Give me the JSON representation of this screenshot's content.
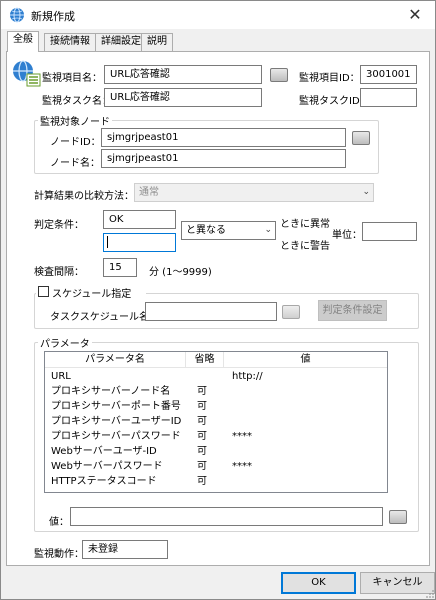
{
  "window": {
    "title": "新規作成",
    "close_glyph": "✕"
  },
  "tabs": [
    {
      "label": "全般"
    },
    {
      "label": "接続情報"
    },
    {
      "label": "詳細設定"
    },
    {
      "label": "説明"
    }
  ],
  "general": {
    "item_name_label": "監視項目名：",
    "item_name_value": "URL応答確認",
    "item_id_label": "監視項目ID：",
    "item_id_value": "3001001",
    "task_name_label": "監視タスク名：",
    "task_name_value": "URL応答確認",
    "task_id_label": "監視タスクID：",
    "task_id_value": ""
  },
  "target": {
    "legend": "監視対象ノード",
    "node_id_label": "ノードID：",
    "node_id_value": "sjmgrjpeast01",
    "node_name_label": "ノード名：",
    "node_name_value": "sjmgrjpeast01"
  },
  "compare": {
    "label": "計算結果の比較方法：",
    "value": "通常"
  },
  "condition": {
    "label": "判定条件：",
    "value1": "OK",
    "value2": "",
    "operator": "と異なる",
    "abnormal_text": "ときに異常",
    "warning_text": "ときに警告",
    "unit_label": "単位：",
    "unit_value": ""
  },
  "interval": {
    "label": "検査間隔：",
    "value": "15",
    "suffix": "分 (1〜9999)"
  },
  "schedule": {
    "checkbox_label": "スケジュール指定",
    "checked": false,
    "task_schedule_label": "タスクスケジュール名：",
    "task_schedule_value": "",
    "condition_button": "判定条件設定"
  },
  "params": {
    "legend": "パラメータ",
    "headers": {
      "name": "パラメータ名",
      "omit": "省略",
      "value": "値"
    },
    "rows": [
      {
        "name": "URL",
        "omit": "",
        "value": "http://"
      },
      {
        "name": "プロキシサーバーノード名",
        "omit": "可",
        "value": ""
      },
      {
        "name": "プロキシサーバーポート番号",
        "omit": "可",
        "value": ""
      },
      {
        "name": "プロキシサーバーユーザーID",
        "omit": "可",
        "value": ""
      },
      {
        "name": "プロキシサーバーパスワード",
        "omit": "可",
        "value": "****"
      },
      {
        "name": "Webサーバーユーザ-ID",
        "omit": "可",
        "value": ""
      },
      {
        "name": "Webサーバーパスワード",
        "omit": "可",
        "value": "****"
      },
      {
        "name": "HTTPステータスコード",
        "omit": "可",
        "value": ""
      }
    ],
    "value_label": "値：",
    "value_input": ""
  },
  "action": {
    "label": "監視動作：",
    "value": "未登録"
  },
  "footer": {
    "ok": "OK",
    "cancel": "キャンセル"
  },
  "colors": {
    "accent": "#0078d7",
    "panel": "#f0f0f0"
  }
}
